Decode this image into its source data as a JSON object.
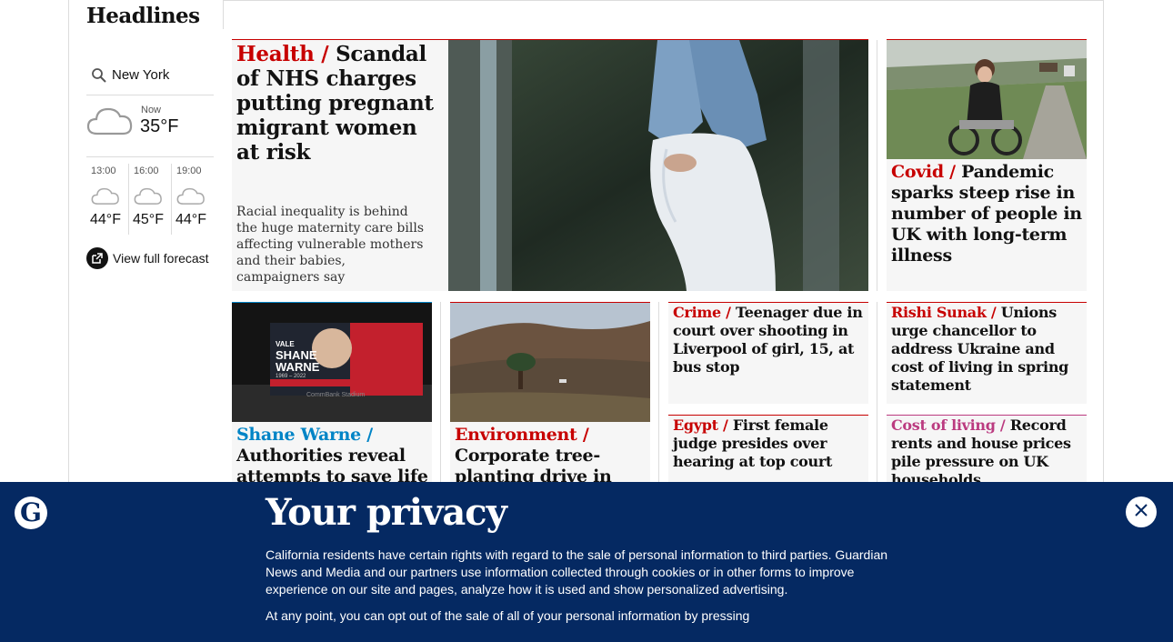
{
  "section": {
    "title": "Headlines"
  },
  "weather": {
    "location": "New York",
    "now_label": "Now",
    "now_temp": "35°F",
    "hours": [
      {
        "time": "13:00",
        "temp": "44°F"
      },
      {
        "time": "16:00",
        "temp": "45°F"
      },
      {
        "time": "19:00",
        "temp": "44°F"
      }
    ],
    "forecast_link": "View full forecast",
    "icon": "cloud-icon"
  },
  "stories": {
    "lead": {
      "kicker": "Health /",
      "headline": "Scandal of NHS charges putting pregnant migrant women at risk",
      "standfirst": "Racial inequality is behind the huge maternity care bills affecting vulnerable mothers and their babies, campaigners say"
    },
    "covid": {
      "kicker": "Covid /",
      "headline": "Pandemic sparks steep rise in number of people in UK with long-term illness"
    },
    "warne": {
      "kicker": "Shane Warne /",
      "headline": "Authorities reveal attempts to save life of",
      "image_text": [
        "VALE",
        "SHANE",
        "WARNE",
        "1969 – 2022",
        "CommBank Stadium"
      ]
    },
    "environment": {
      "kicker": "Environment /",
      "headline": "Corporate tree-planting drive in"
    },
    "crime": {
      "kicker": "Crime /",
      "headline": "Teenager due in court over shooting in Liverpool of girl, 15, at bus stop"
    },
    "sunak": {
      "kicker": "Rishi Sunak /",
      "headline": "Unions urge chancellor to address Ukraine and cost of living in spring statement"
    },
    "egypt": {
      "kicker": "Egypt /",
      "headline": "First female judge presides over hearing at top court"
    },
    "living": {
      "kicker": "Cost of living /",
      "headline": "Record rents and house prices pile pressure on UK households"
    }
  },
  "colors": {
    "news_red": "#c70000",
    "sport_blue": "#0084c6",
    "lifestyle_pink": "#bb3b80",
    "privacy_bg": "#052962"
  },
  "privacy": {
    "title": "Your privacy",
    "body1": "California residents have certain rights with regard to the sale of personal information to third parties. Guardian News and Media and our partners use information collected through cookies or in other forms to improve experience on our site and pages, analyze how it is used and show personalized advertising.",
    "body2": "At any point, you can opt out of the sale of all of your personal information by pressing",
    "logo_letter": "G"
  }
}
